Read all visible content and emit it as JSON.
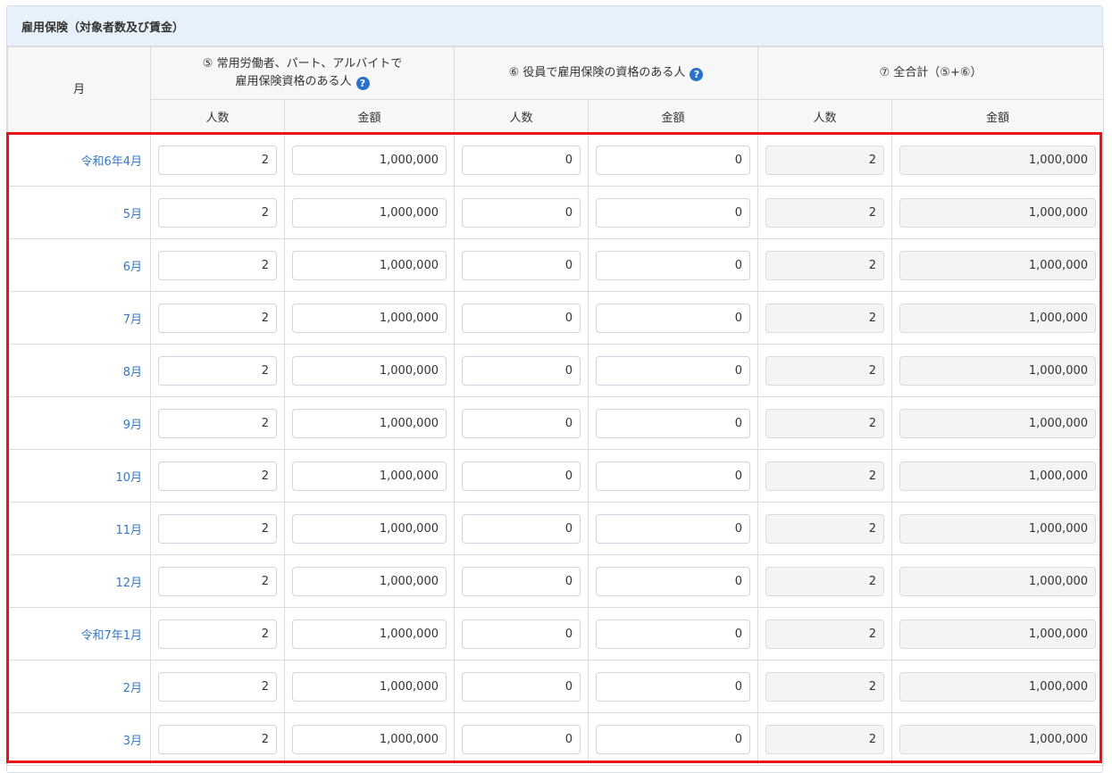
{
  "panel": {
    "title": "雇用保険（対象者数及び賃金）"
  },
  "headers": {
    "month": "月",
    "group5_line1": "⑤ 常用労働者、パート、アルバイトで",
    "group5_line2": "雇用保険資格のある人",
    "group6": "⑥ 役員で雇用保険の資格のある人",
    "group7": "⑦ 全合計（⑤+⑥）",
    "count": "人数",
    "amount": "金額",
    "help_icon": "?"
  },
  "icons": {
    "help": "question-circle-icon"
  },
  "colors": {
    "accent": "#2a72c9",
    "month_link": "#3478c6",
    "highlight": "#e8131b",
    "title_bg": "#e7f1fb"
  },
  "rows": [
    {
      "month": "令和6年4月",
      "c5_count": "2",
      "c5_amount": "1,000,000",
      "c6_count": "0",
      "c6_amount": "0",
      "c7_count": "2",
      "c7_amount": "1,000,000"
    },
    {
      "month": "5月",
      "c5_count": "2",
      "c5_amount": "1,000,000",
      "c6_count": "0",
      "c6_amount": "0",
      "c7_count": "2",
      "c7_amount": "1,000,000"
    },
    {
      "month": "6月",
      "c5_count": "2",
      "c5_amount": "1,000,000",
      "c6_count": "0",
      "c6_amount": "0",
      "c7_count": "2",
      "c7_amount": "1,000,000"
    },
    {
      "month": "7月",
      "c5_count": "2",
      "c5_amount": "1,000,000",
      "c6_count": "0",
      "c6_amount": "0",
      "c7_count": "2",
      "c7_amount": "1,000,000"
    },
    {
      "month": "8月",
      "c5_count": "2",
      "c5_amount": "1,000,000",
      "c6_count": "0",
      "c6_amount": "0",
      "c7_count": "2",
      "c7_amount": "1,000,000"
    },
    {
      "month": "9月",
      "c5_count": "2",
      "c5_amount": "1,000,000",
      "c6_count": "0",
      "c6_amount": "0",
      "c7_count": "2",
      "c7_amount": "1,000,000"
    },
    {
      "month": "10月",
      "c5_count": "2",
      "c5_amount": "1,000,000",
      "c6_count": "0",
      "c6_amount": "0",
      "c7_count": "2",
      "c7_amount": "1,000,000"
    },
    {
      "month": "11月",
      "c5_count": "2",
      "c5_amount": "1,000,000",
      "c6_count": "0",
      "c6_amount": "0",
      "c7_count": "2",
      "c7_amount": "1,000,000"
    },
    {
      "month": "12月",
      "c5_count": "2",
      "c5_amount": "1,000,000",
      "c6_count": "0",
      "c6_amount": "0",
      "c7_count": "2",
      "c7_amount": "1,000,000"
    },
    {
      "month": "令和7年1月",
      "c5_count": "2",
      "c5_amount": "1,000,000",
      "c6_count": "0",
      "c6_amount": "0",
      "c7_count": "2",
      "c7_amount": "1,000,000"
    },
    {
      "month": "2月",
      "c5_count": "2",
      "c5_amount": "1,000,000",
      "c6_count": "0",
      "c6_amount": "0",
      "c7_count": "2",
      "c7_amount": "1,000,000"
    },
    {
      "month": "3月",
      "c5_count": "2",
      "c5_amount": "1,000,000",
      "c6_count": "0",
      "c6_amount": "0",
      "c7_count": "2",
      "c7_amount": "1,000,000"
    }
  ]
}
